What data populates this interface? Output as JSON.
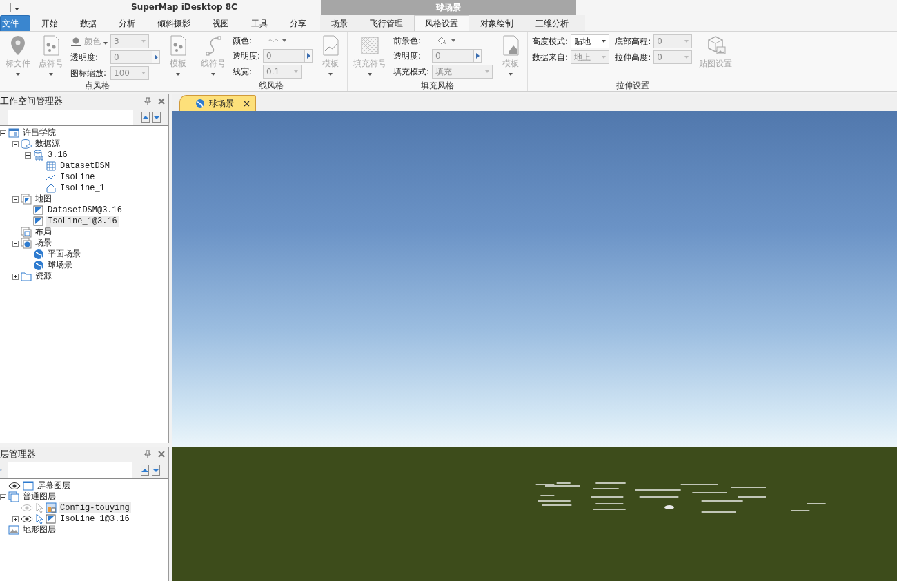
{
  "window": {
    "title": "SuperMap iDesktop 8C"
  },
  "tabs": [
    {
      "label": "文件",
      "kind": "file",
      "selected": false
    },
    {
      "label": "开始",
      "kind": "tab",
      "selected": false
    },
    {
      "label": "数据",
      "kind": "tab",
      "selected": false
    },
    {
      "label": "分析",
      "kind": "tab",
      "selected": false
    },
    {
      "label": "倾斜摄影",
      "kind": "tab",
      "selected": false
    },
    {
      "label": "视图",
      "kind": "tab",
      "selected": false
    },
    {
      "label": "工具",
      "kind": "tab",
      "selected": false
    },
    {
      "label": "分享",
      "kind": "tab",
      "selected": false
    }
  ],
  "context_group": {
    "label": "球场景",
    "tabs": [
      {
        "label": "场景",
        "selected": false
      },
      {
        "label": "飞行管理",
        "selected": false
      },
      {
        "label": "风格设置",
        "selected": true
      },
      {
        "label": "对象绘制",
        "selected": false
      },
      {
        "label": "三维分析",
        "selected": false
      }
    ]
  },
  "ribbon": [
    {
      "title": "点风格",
      "columns": [
        {
          "kind": "large",
          "label": "标文件",
          "disabled": true
        },
        {
          "kind": "large",
          "label": "点符号",
          "disabled": true
        },
        {
          "kind": "fields",
          "rows": [
            {
              "label": "颜色",
              "kind": "picker",
              "label_disabled": true,
              "control": {
                "kind": "combo",
                "value": "3",
                "disabled": true
              }
            },
            {
              "label": "透明度:",
              "kind": "text",
              "control": {
                "kind": "spin",
                "value": "0",
                "disabled": true
              }
            },
            {
              "label": "图标缩放:",
              "kind": "text",
              "control": {
                "kind": "combo",
                "value": "100",
                "disabled": true
              }
            }
          ]
        },
        {
          "kind": "large",
          "label": "模板",
          "disabled": true
        }
      ]
    },
    {
      "title": "线风格",
      "columns": [
        {
          "kind": "large",
          "label": "线符号",
          "disabled": true
        },
        {
          "kind": "fields",
          "rows": [
            {
              "label": "颜色:",
              "kind": "text",
              "control": {
                "kind": "picker",
                "disabled": true
              }
            },
            {
              "label": "透明度:",
              "kind": "text",
              "control": {
                "kind": "spin",
                "value": "0",
                "disabled": true
              }
            },
            {
              "label": "线宽:",
              "kind": "text",
              "control": {
                "kind": "combo",
                "value": "0.1",
                "disabled": true
              }
            }
          ]
        },
        {
          "kind": "large",
          "label": "模板",
          "disabled": true
        }
      ]
    },
    {
      "title": "填充风格",
      "columns": [
        {
          "kind": "large",
          "label": "填充符号",
          "disabled": true
        },
        {
          "kind": "fields",
          "rows": [
            {
              "label": "前景色:",
              "kind": "text",
              "control": {
                "kind": "picker",
                "disabled": true
              }
            },
            {
              "label": "透明度:",
              "kind": "text",
              "control": {
                "kind": "spin",
                "value": "0",
                "disabled": true
              }
            },
            {
              "label": "填充模式:",
              "kind": "text",
              "control": {
                "kind": "combo",
                "value": "填充",
                "disabled": true
              }
            }
          ]
        },
        {
          "kind": "large",
          "label": "模板",
          "disabled": true
        }
      ]
    },
    {
      "title": "拉伸设置",
      "columns": [
        {
          "kind": "fields",
          "rows": [
            {
              "label": "高度模式:",
              "kind": "text",
              "control": {
                "kind": "combo",
                "value": "贴地",
                "disabled": false
              }
            },
            {
              "label": "数据来自:",
              "kind": "text",
              "control": {
                "kind": "combo",
                "value": "地上",
                "disabled": true
              }
            }
          ]
        },
        {
          "kind": "fields",
          "rows": [
            {
              "label": "底部高程:",
              "kind": "text",
              "control": {
                "kind": "combo",
                "value": "0",
                "disabled": true
              }
            },
            {
              "label": "拉伸高度:",
              "kind": "text",
              "control": {
                "kind": "combo",
                "value": "0",
                "disabled": true
              }
            }
          ]
        },
        {
          "kind": "large",
          "label": "贴图设置",
          "disabled": true
        }
      ]
    }
  ],
  "workspace": {
    "title": "工作空间管理器",
    "tree": [
      {
        "label": "许昌学院",
        "kind": "workspace",
        "expanded": true,
        "selected": false,
        "children": [
          {
            "label": "数据源",
            "kind": "datasources",
            "expanded": true,
            "selected": false,
            "children": [
              {
                "label": "3.16",
                "kind": "datasource",
                "expanded": true,
                "selected": false,
                "children": [
                  {
                    "label": "DatasetDSM",
                    "kind": "grid",
                    "selected": false
                  },
                  {
                    "label": "IsoLine",
                    "kind": "line",
                    "selected": false
                  },
                  {
                    "label": "IsoLine_1",
                    "kind": "region",
                    "selected": false
                  }
                ]
              }
            ]
          },
          {
            "label": "地图",
            "kind": "maps",
            "expanded": true,
            "selected": false,
            "children": [
              {
                "label": "DatasetDSM@3.16",
                "kind": "map",
                "selected": false
              },
              {
                "label": "IsoLine_1@3.16",
                "kind": "map",
                "selected": true
              }
            ]
          },
          {
            "label": "布局",
            "kind": "layouts",
            "selected": false
          },
          {
            "label": "场景",
            "kind": "scenes",
            "expanded": true,
            "selected": false,
            "children": [
              {
                "label": "平面场景",
                "kind": "scene",
                "selected": false
              },
              {
                "label": "球场景",
                "kind": "scene",
                "selected": false
              }
            ]
          },
          {
            "label": "资源",
            "kind": "resources",
            "expanded": false,
            "selected": false
          }
        ]
      }
    ]
  },
  "layers": {
    "title": "层管理器",
    "tree": [
      {
        "label": "屏幕图层",
        "kind": "screen",
        "visible": true,
        "selected": false
      },
      {
        "label": "普通图层",
        "kind": "normal",
        "expanded": true,
        "selected": false,
        "children": [
          {
            "label": "Config-touying",
            "kind": "model",
            "visible": false,
            "selectable": false,
            "selected": true
          },
          {
            "label": "IsoLine_1@3.16",
            "kind": "map",
            "visible": true,
            "selectable": true,
            "expanded": false,
            "selected": false
          }
        ]
      },
      {
        "label": "地形图层",
        "kind": "terrain",
        "selected": false
      }
    ]
  },
  "document_tabs": [
    {
      "label": "球场景",
      "selected": true
    }
  ]
}
